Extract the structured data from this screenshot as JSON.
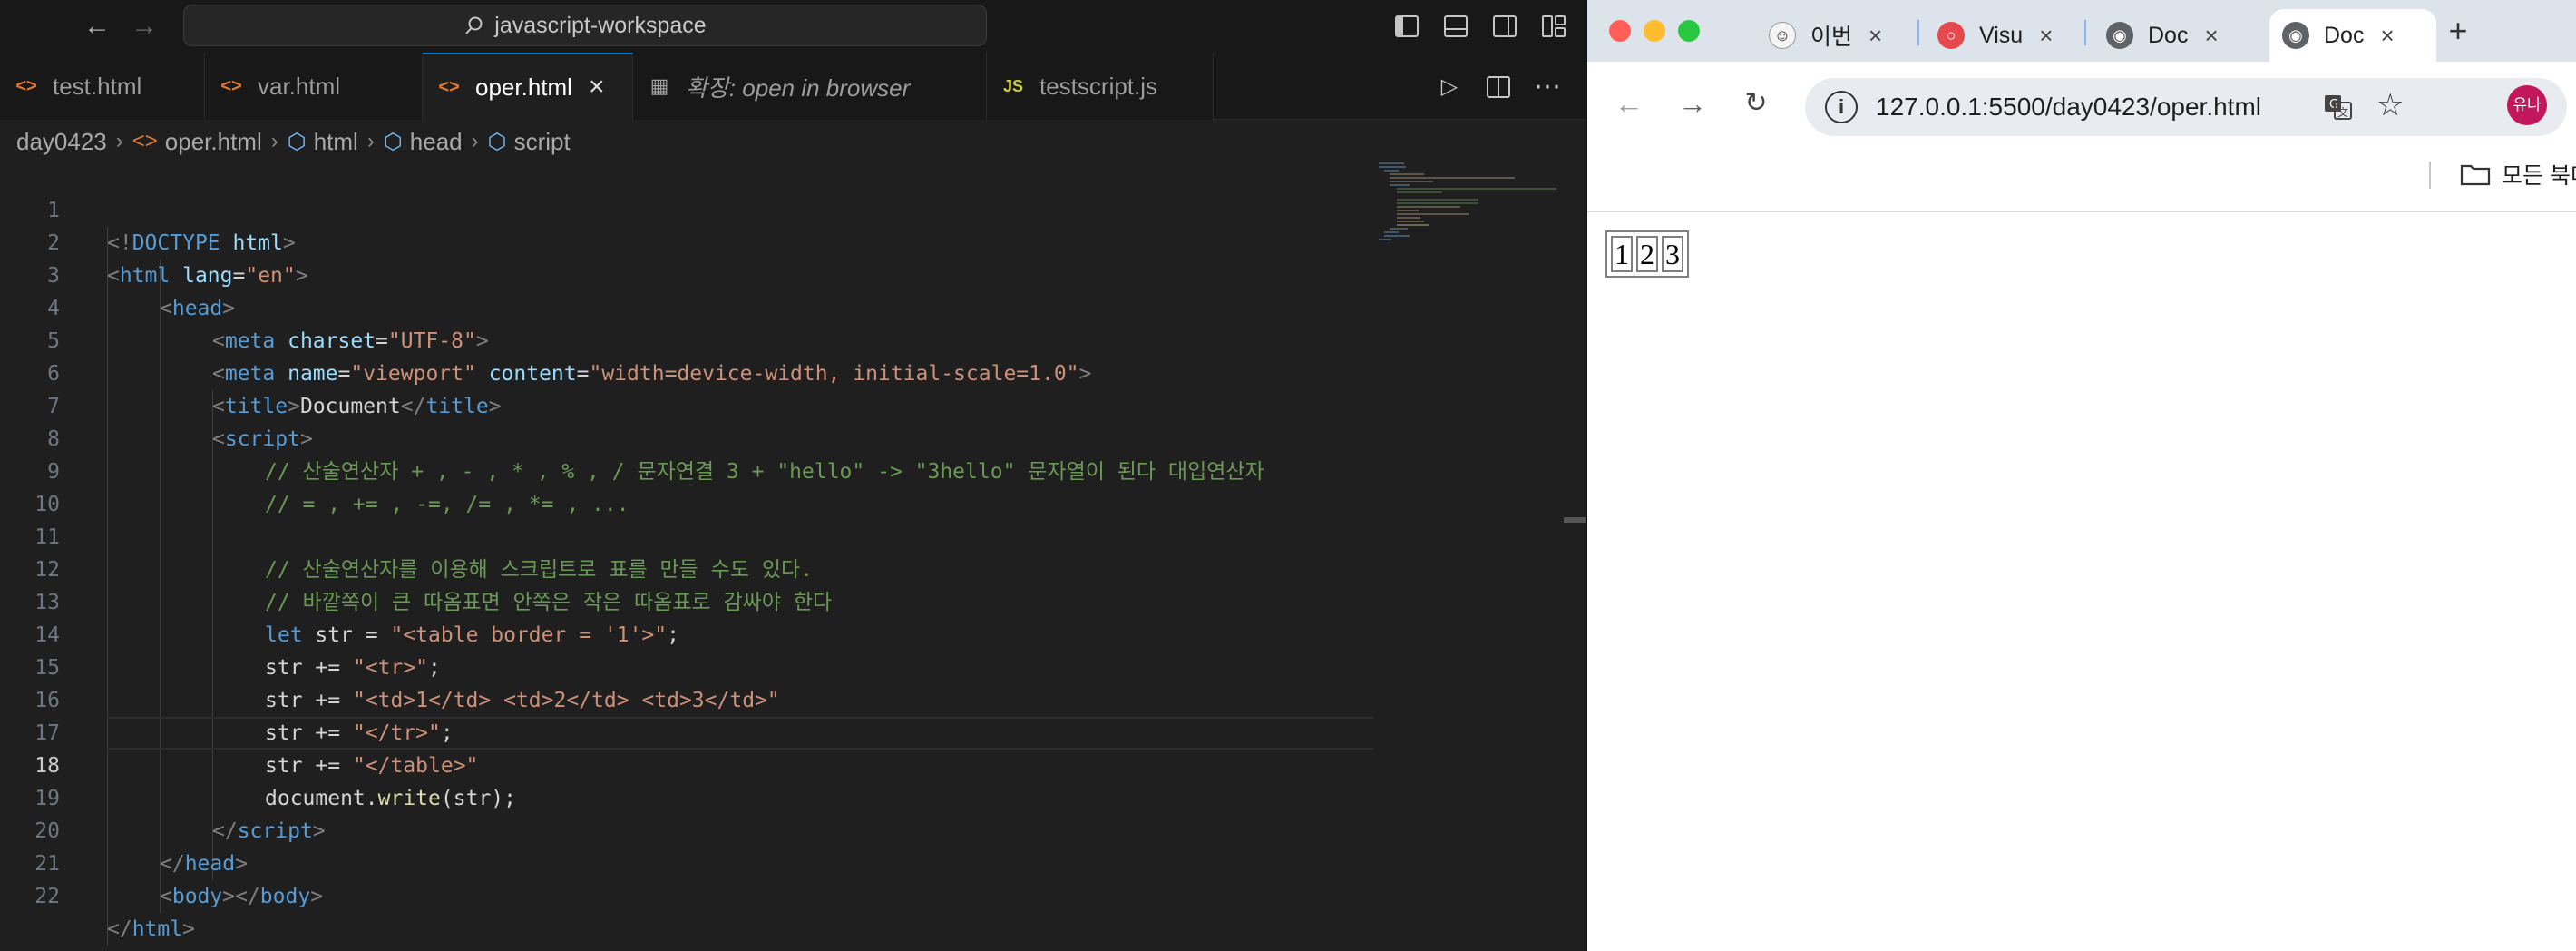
{
  "vscode": {
    "command_center": "javascript-workspace",
    "tabs": [
      {
        "label": "test.html",
        "icon": "html"
      },
      {
        "label": "var.html",
        "icon": "html"
      },
      {
        "label": "oper.html",
        "icon": "html",
        "active": true
      },
      {
        "label": "확장: open in browser",
        "icon": "extension"
      },
      {
        "label": "testscript.js",
        "icon": "js"
      }
    ],
    "tab_icon_js": "JS",
    "breadcrumb": [
      "day0423",
      "oper.html",
      "html",
      "head",
      "script"
    ],
    "current_line": 18,
    "line_numbers": [
      "1",
      "2",
      "3",
      "4",
      "5",
      "6",
      "7",
      "8",
      "9",
      "10",
      "11",
      "12",
      "13",
      "14",
      "15",
      "16",
      "17",
      "18",
      "19",
      "20",
      "21",
      "22"
    ],
    "code": {
      "l1": [
        "<!",
        "DOCTYPE",
        " html",
        ">"
      ],
      "l2": [
        "<",
        "html",
        " lang",
        "=",
        "\"en\"",
        ">"
      ],
      "l3": [
        "<",
        "head",
        ">"
      ],
      "l4": [
        "<",
        "meta",
        " charset",
        "=",
        "\"UTF-8\"",
        ">"
      ],
      "l5": [
        "<",
        "meta",
        " name",
        "=",
        "\"viewport\"",
        " content",
        "=",
        "\"width=device-width, initial-scale=1.0\"",
        ">"
      ],
      "l6": [
        "<",
        "title",
        ">",
        "Document",
        "</",
        "title",
        ">"
      ],
      "l7": [
        "<",
        "script",
        ">"
      ],
      "l8": "// 산술연산자 + , - , * , % , / 문자연결 3 + \"hello\" -> \"3hello\" 문자열이 된다 대입연산자",
      "l9": "// = , += , -=, /= , *= , ...",
      "l11": "// 산술연산자를 이용해 스크립트로 표를 만들 수도 있다.",
      "l12": "// 바깥쪽이 큰 따옴표면 안쪽은 작은 따옴표로 감싸야 한다",
      "l13": [
        "let",
        " str",
        " = ",
        "\"<table border = '1'>\"",
        ";"
      ],
      "l14": [
        "str",
        " += ",
        "\"<tr>\"",
        ";"
      ],
      "l15": [
        "str",
        " += ",
        "\"<td>1</td> <td>2</td> <td>3</td>\""
      ],
      "l16": [
        "str",
        " += ",
        "\"</tr>\"",
        ";"
      ],
      "l17": [
        "str",
        " += ",
        "\"</table>\""
      ],
      "l18": [
        "document",
        ".",
        "write",
        "(",
        "str",
        ");"
      ],
      "l19": [
        "</",
        "script",
        ">"
      ],
      "l20": [
        "</",
        "head",
        ">"
      ],
      "l21": [
        "<",
        "body",
        "></",
        "body",
        ">"
      ],
      "l22": [
        "</",
        "html",
        ">"
      ]
    }
  },
  "browser": {
    "tabs": [
      {
        "label": "이번"
      },
      {
        "label": "Visu"
      },
      {
        "label": "Doc"
      },
      {
        "label": "Doc",
        "active": true
      }
    ],
    "url": "127.0.0.1:5500/day0423/oper.html",
    "avatar_initials": "유나",
    "bookmark_folder": "모든 북마",
    "table_cells": [
      "1",
      "2",
      "3"
    ]
  },
  "colors": {
    "accent": "#0078d4",
    "avatar": "#c2185b"
  }
}
